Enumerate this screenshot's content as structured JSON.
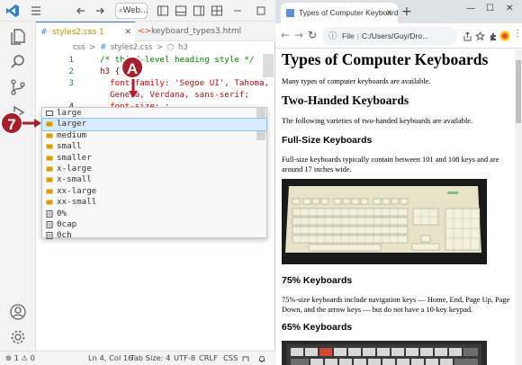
{
  "vscode": {
    "title_search": "Web...",
    "tabs": [
      {
        "label": "styles2.css 1",
        "icon": "#"
      },
      {
        "label": "keyboard_types3.html",
        "icon": "<>"
      }
    ],
    "breadcrumb": [
      "css",
      ">",
      "#",
      "styles2.css",
      ">",
      "h3"
    ],
    "line_numbers": [
      "1",
      "2",
      "3",
      "4"
    ],
    "code": {
      "line1": "/* third-level heading style */",
      "line2_sel": "h3",
      "line2_brace": " {",
      "line3_prop": "  font-family",
      "line3_val": ": 'Segoe UI', Tahoma,",
      "line3b": "  Geneva, Verdana, sans-serif;",
      "line4_prop": "  font-size",
      "line4_rest": ": ;"
    },
    "suggestions": [
      "large",
      "larger",
      "medium",
      "small",
      "smaller",
      "x-large",
      "x-small",
      "xx-large",
      "xx-small",
      "0%",
      "0cap",
      "0ch"
    ],
    "status": {
      "problems": "⊗ 1 ⚠ 0",
      "position": "Ln 4, Col 16",
      "tab_size": "Tab Size: 4",
      "encoding": "UTF-8",
      "eol": "CRLF",
      "language": "CSS"
    }
  },
  "callouts": {
    "step": "7",
    "marker": "A"
  },
  "chrome": {
    "tab_title": "Types of Computer Keyboards",
    "address_prefix": "File",
    "address": "C:/Users/Guy/Dro...",
    "page": {
      "h1": "Types of Computer Keyboards",
      "intro": "Many types of computer keyboards are available.",
      "h2": "Two-Handed Keyboards",
      "p2": "The following varieties of two-handed keyboards are available.",
      "h3a": "Full-Size Keyboards",
      "p3a": "Full-size keyboards typically contain between 101 and 108 keys and are around 17 inches wide.",
      "h3b": "75% Keyboards",
      "p3b": "75%-size keyboards include navigation keys — Home, End, Page Up, Page Down, and the arrow keys — but do not have a 10-key keypad.",
      "h3c": "65% Keyboards"
    }
  },
  "colors": {
    "callout": "#a3202d",
    "accent": "#3b82d6"
  }
}
